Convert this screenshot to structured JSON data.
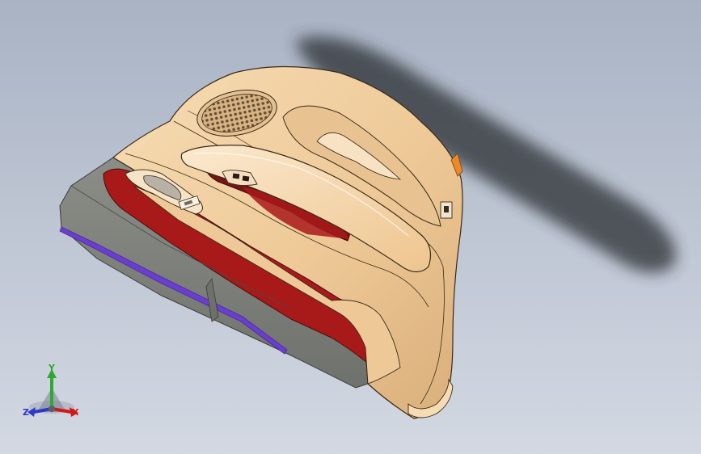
{
  "viewport": {
    "background_top": "#a9b3c4",
    "background_bottom": "#d3d8e2"
  },
  "model": {
    "shell_color": "#f1cfa0",
    "shell_edge_color": "#3a2a18",
    "accent_color": "#a8191a",
    "lower_trim_color": "#7d7f79",
    "edge_strip_color": "#6a3fd0",
    "shadow_color": "#2b2d33",
    "clip_color": "#ec8a2a"
  },
  "triad": {
    "icon": "coordinate-axes-icon",
    "y_label": "Y",
    "x_label": "X",
    "z_label": "Z",
    "y_color": "#2ea832",
    "x_color": "#d01818",
    "z_color": "#2c3ac4"
  }
}
